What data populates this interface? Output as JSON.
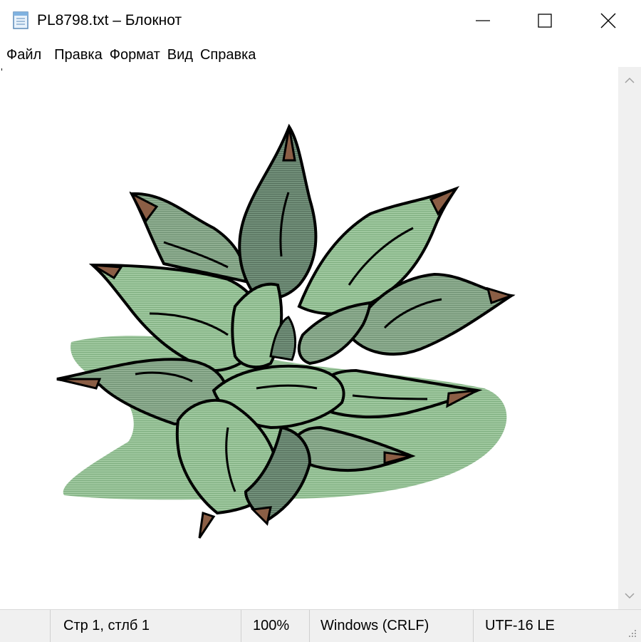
{
  "window": {
    "title": "PL8798.txt – Блокнот",
    "controls": {
      "minimize": "—",
      "maximize": "☐",
      "close": "✕"
    }
  },
  "menu": [
    "Файл",
    "Правка",
    "Формат",
    "Вид",
    "Справка"
  ],
  "editor": {
    "content_description": "ASCII-art style image of a green succulent plant with brown leaf tips",
    "colors": {
      "light_leaf": "#9fc89f",
      "mid_leaf": "#88a88a",
      "dark_leaf": "#6e8a72",
      "tip": "#8b5e45",
      "outline": "#000000"
    }
  },
  "status": {
    "position": "Стр 1, стлб 1",
    "zoom": "100%",
    "line_endings": "Windows (CRLF)",
    "encoding": "UTF-16 LE"
  },
  "icons": [
    "notepad-icon",
    "minimize-icon",
    "maximize-icon",
    "close-icon",
    "scroll-up-icon",
    "scroll-down-icon",
    "resize-grip-icon"
  ]
}
